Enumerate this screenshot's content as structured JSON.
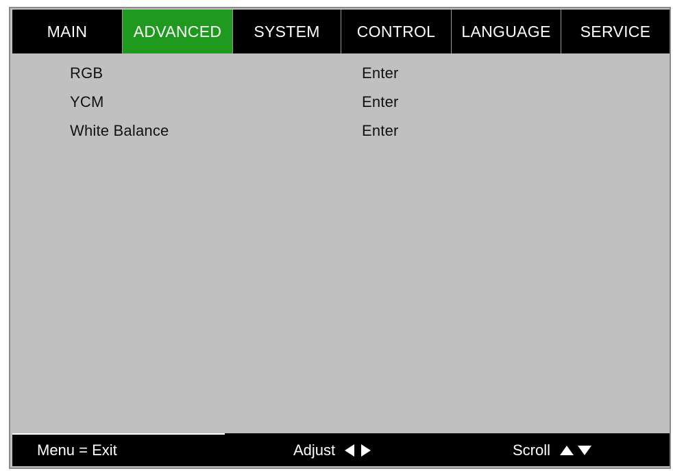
{
  "tabs": [
    {
      "label": "MAIN",
      "active": false
    },
    {
      "label": "ADVANCED",
      "active": true
    },
    {
      "label": "SYSTEM",
      "active": false
    },
    {
      "label": "CONTROL",
      "active": false
    },
    {
      "label": "LANGUAGE",
      "active": false
    },
    {
      "label": "SERVICE",
      "active": false
    }
  ],
  "menu": {
    "items": [
      {
        "label": "RGB",
        "value": "Enter"
      },
      {
        "label": "YCM",
        "value": "Enter"
      },
      {
        "label": "White Balance",
        "value": "Enter"
      }
    ]
  },
  "footer": {
    "exit_hint": "Menu = Exit",
    "adjust_hint": "Adjust",
    "adjust_icon": "left-right-arrows-icon",
    "scroll_hint": "Scroll",
    "scroll_icon": "up-down-arrows-icon"
  },
  "colors": {
    "active_tab": "#1f9a1f",
    "tab_bar": "#000000",
    "panel": "#c0c0c0"
  }
}
